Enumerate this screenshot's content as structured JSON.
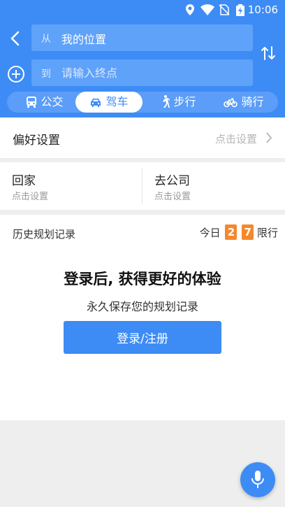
{
  "status_bar": {
    "time": "10:06"
  },
  "route": {
    "origin_prefix": "从",
    "origin_value": "我的位置",
    "destination_prefix": "到",
    "destination_placeholder": "请输入终点"
  },
  "modes": [
    {
      "label": "公交",
      "icon": "bus-icon"
    },
    {
      "label": "驾车",
      "icon": "car-icon",
      "selected": true
    },
    {
      "label": "步行",
      "icon": "walk-icon"
    },
    {
      "label": "骑行",
      "icon": "bike-icon"
    }
  ],
  "preferences": {
    "title": "偏好设置",
    "hint": "点击设置"
  },
  "shortcuts": [
    {
      "title": "回家",
      "subtitle": "点击设置"
    },
    {
      "title": "去公司",
      "subtitle": "点击设置"
    }
  ],
  "history": {
    "title": "历史规划记录",
    "limit_prefix": "今日",
    "limit_digits": [
      "2",
      "7"
    ],
    "limit_suffix": "限行",
    "login_title": "登录后, 获得更好的体验",
    "login_subtitle": "永久保存您的规划记录",
    "login_button": "登录/注册"
  },
  "colors": {
    "primary": "#3d8cf5",
    "field": "#5fa2fa",
    "limit_badge": "#f5882b"
  }
}
